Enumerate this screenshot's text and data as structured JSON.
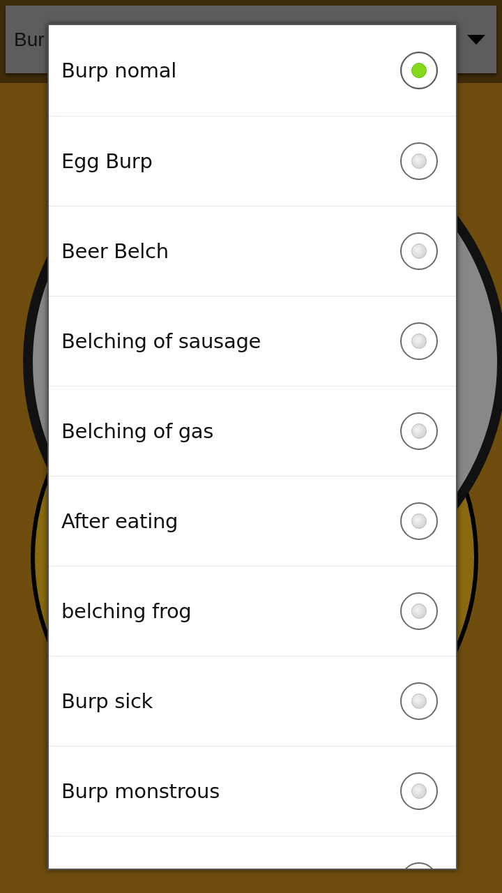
{
  "spinner": {
    "value": "Bur"
  },
  "dialog": {
    "options": [
      {
        "label": "Burp nomal",
        "selected": true
      },
      {
        "label": "Egg Burp",
        "selected": false
      },
      {
        "label": "Beer Belch",
        "selected": false
      },
      {
        "label": "Belching of sausage",
        "selected": false
      },
      {
        "label": "Belching of gas",
        "selected": false
      },
      {
        "label": "After eating",
        "selected": false
      },
      {
        "label": "belching frog",
        "selected": false
      },
      {
        "label": "Burp sick",
        "selected": false
      },
      {
        "label": "Burp monstrous",
        "selected": false
      },
      {
        "selected": false
      }
    ]
  }
}
